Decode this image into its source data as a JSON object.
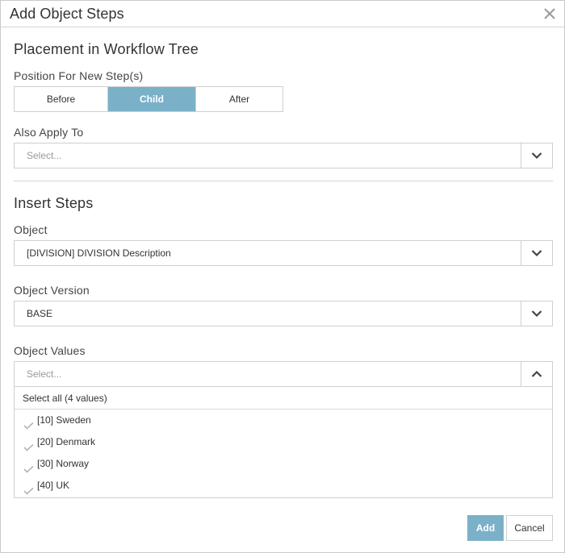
{
  "dialog": {
    "title": "Add Object Steps",
    "close_icon": "close-icon"
  },
  "placement": {
    "section_title": "Placement in Workflow Tree",
    "position_label": "Position For New Step(s)",
    "positions": [
      {
        "label": "Before",
        "active": false
      },
      {
        "label": "Child",
        "active": true
      },
      {
        "label": "After",
        "active": false
      }
    ],
    "also_apply_label": "Also Apply To",
    "also_apply_placeholder": "Select..."
  },
  "insert": {
    "section_title": "Insert Steps",
    "object_label": "Object",
    "object_value": "[DIVISION] DIVISION Description",
    "version_label": "Object Version",
    "version_value": "BASE",
    "values_label": "Object Values",
    "values_placeholder": "Select...",
    "select_all_label": "Select all (4 values)",
    "options": [
      {
        "label": "[10] Sweden"
      },
      {
        "label": "[20] Denmark"
      },
      {
        "label": "[30] Norway"
      },
      {
        "label": "[40] UK"
      }
    ]
  },
  "footer": {
    "add_label": "Add",
    "cancel_label": "Cancel"
  },
  "colors": {
    "accent": "#7ab1c9",
    "border": "#cfcfcf",
    "text": "#333333",
    "placeholder": "#999999"
  },
  "icons": {
    "chevron_down": "chevron-down-icon",
    "chevron_up": "chevron-up-icon",
    "check": "check-icon"
  }
}
